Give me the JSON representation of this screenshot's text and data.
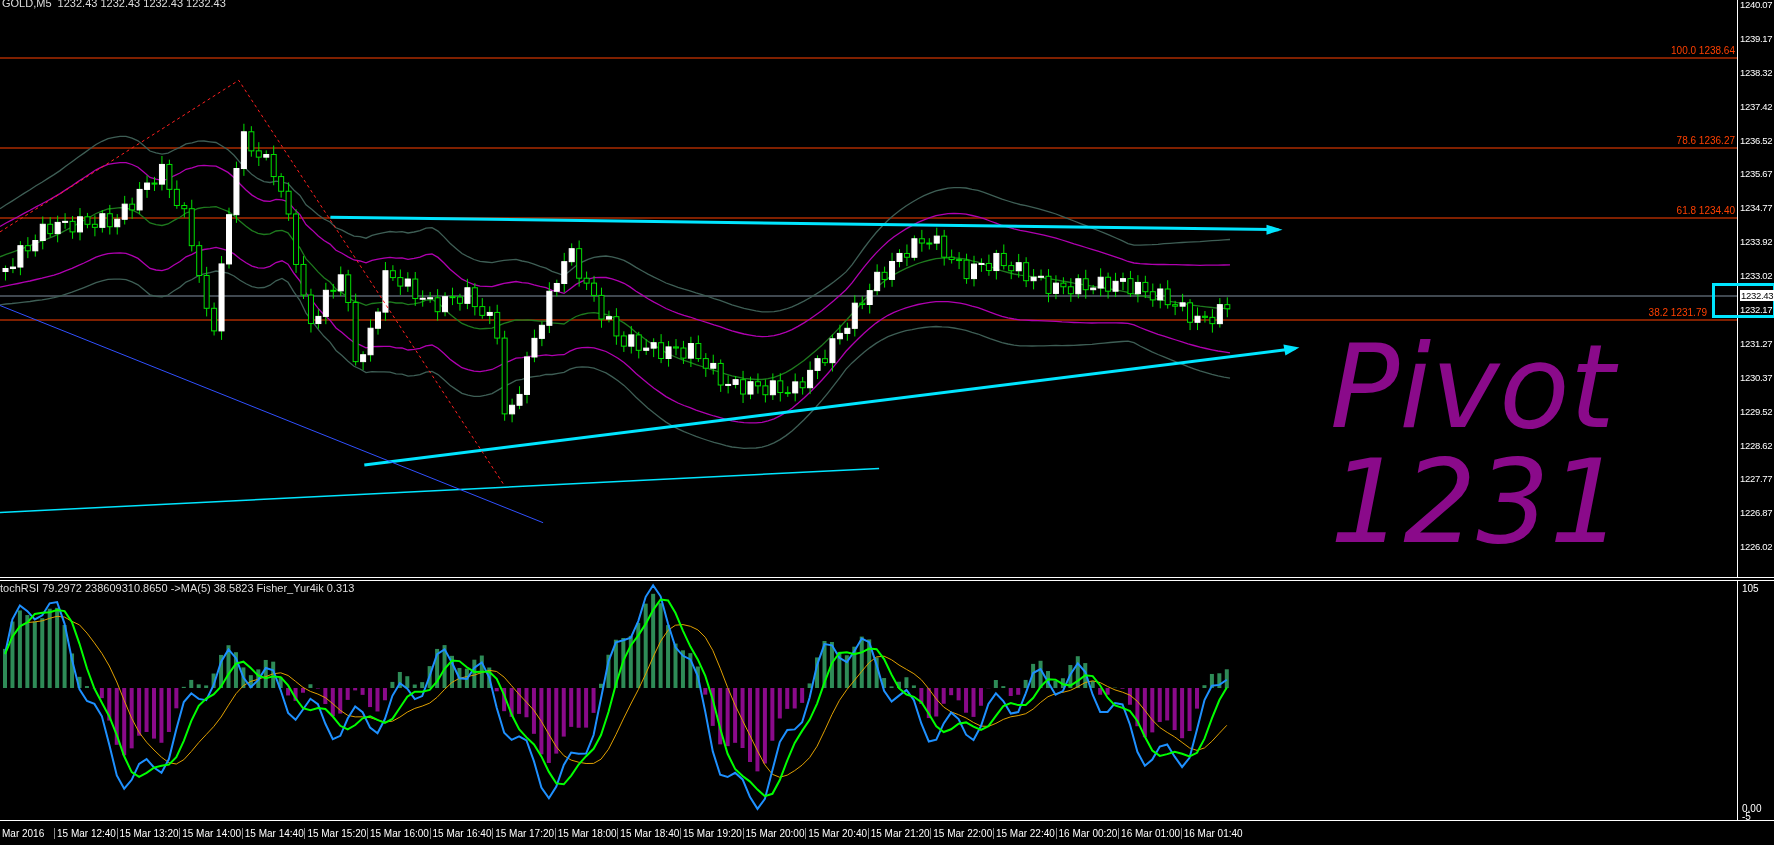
{
  "chart": {
    "header": "GOLD,M5  1232.43 1232.43 1232.43 1232.43",
    "fibonacci_levels": [
      {
        "label": "100.0 1238.64"
      },
      {
        "label": "78.6 1236.27"
      },
      {
        "label": "61.8 1234.40"
      },
      {
        "label": "38.2 1231.79"
      }
    ],
    "handwritten_note": {
      "line_1": "Pivot",
      "line_2": "1231"
    },
    "price_axis": {
      "labels": [
        "1240.07",
        "1239.17",
        "1238.32",
        "1237.42",
        "1236.52",
        "1235.67",
        "1234.77",
        "1233.92",
        "1233.02",
        "1232.17",
        "1231.27",
        "1230.37",
        "1229.52",
        "1228.62",
        "1227.77",
        "1226.87",
        "1226.02"
      ],
      "current_price": "1232.43"
    }
  },
  "indicator": {
    "header": "tochRSI 79.2972 238609310.8650 ->MA(5) 38.5823 Fisher_Yur4ik 0.313",
    "axis_labels": [
      "105",
      "0.00",
      "-5"
    ]
  },
  "time_axis": {
    "labels": [
      "Mar 2016",
      "15 Mar 12:40",
      "15 Mar 13:20",
      "15 Mar 14:00",
      "15 Mar 14:40",
      "15 Mar 15:20",
      "15 Mar 16:00",
      "15 Mar 16:40",
      "15 Mar 17:20",
      "15 Mar 18:00",
      "15 Mar 18:40",
      "15 Mar 19:20",
      "15 Mar 20:00",
      "15 Mar 20:40",
      "15 Mar 21:20",
      "15 Mar 22:00",
      "15 Mar 22:40",
      "16 Mar 00:20",
      "16 Mar 01:00",
      "16 Mar 01:40"
    ]
  }
}
